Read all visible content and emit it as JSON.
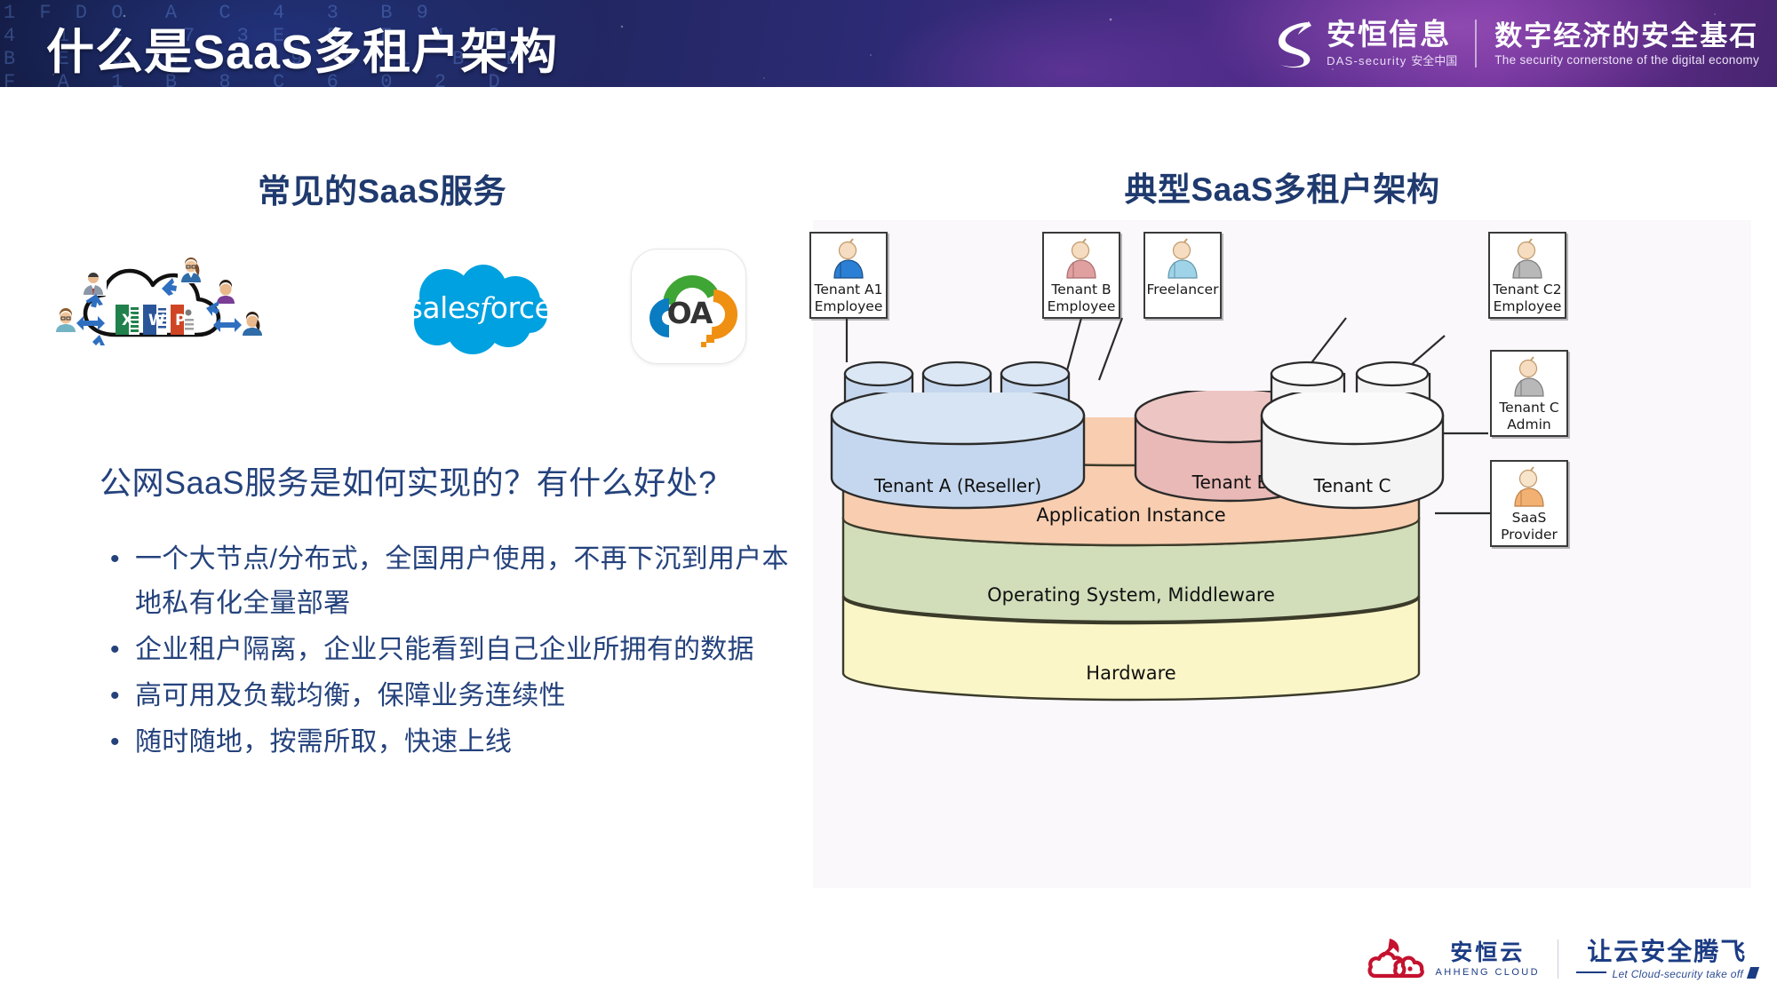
{
  "header": {
    "title": "什么是SaaS多租户架构",
    "code_texts": "1 F D O  A  C  4  3  B 9\n4  1  F   7  3 E  5  F  1  0\nB  E  C  A   2  9  D  1  B  E\nF  A  1  B  8  C  6  0  2  D\nF  O  BE2  F D04  2    1 F D  3  8\n4  7  5926 4   S8   3  C7   2  B",
    "brand": {
      "logo_icon": "das-security-swoosh-logo",
      "name_cn": "安恒信息",
      "name_en": "DAS-security",
      "name_en_suffix": "安全中国",
      "tagline_cn": "数字经济的安全基石",
      "tagline_en": "The security cornerstone of the digital economy"
    },
    "accent_dark": "#121a3e",
    "accent_purple": "#6b2f97"
  },
  "left": {
    "heading": "常见的SaaS服务",
    "logos": [
      {
        "name": "cloud-users-office-illustration",
        "label": ""
      },
      {
        "name": "salesforce-logo",
        "label": "salesforce",
        "label_pre": "sale",
        "label_italic": "sf",
        "label_post": "orce",
        "color": "#00a1e0"
      },
      {
        "name": "oa-cloud-logo",
        "label": "OA",
        "colors": [
          "#0a7cc1",
          "#3fa535",
          "#ef9012"
        ]
      }
    ],
    "subtitle": "公网SaaS服务是如何实现的？有什么好处?",
    "bullet_marker": "•",
    "bullets": [
      "一个大节点/分布式，全国用户使用，不再下沉到用户本地私有化全量部署",
      "企业租户隔离，企业只能看到自己企业所拥有的数据",
      "高可用及负载均衡，保障业务连续性",
      "随时随地，按需所取，快速上线"
    ],
    "text_color": "#24427c",
    "heading_color": "#1f3a6e"
  },
  "right": {
    "heading": "典型SaaS多租户架构",
    "panel_bg": "#fbf8fc",
    "diagram": {
      "actors": [
        {
          "name": "tenant-a1-employee",
          "label": "Tenant A1\nEmployee",
          "figure_color": "#2b7fd4"
        },
        {
          "name": "tenant-b-employee",
          "label": "Tenant B\nEmployee",
          "figure_color": "#e0a0a0"
        },
        {
          "name": "freelancer",
          "label": "Freelancer",
          "figure_color": "#9fd4e8"
        },
        {
          "name": "tenant-c2-employee",
          "label": "Tenant C2\nEmployee",
          "figure_color": "#b8b8b8"
        },
        {
          "name": "tenant-c-admin",
          "label": "Tenant C\nAdmin",
          "figure_color": "#b8b8b8"
        },
        {
          "name": "saas-provider",
          "label": "SaaS\nProvider",
          "figure_color": "#f2b173"
        }
      ],
      "tenants": [
        {
          "name": "tenant-a",
          "label": "Tenant A (Reseller)",
          "color": "#c5d7ee",
          "databases": [
            "A1",
            "A2",
            "A3"
          ]
        },
        {
          "name": "tenant-b",
          "label": "Tenant B",
          "color": "#e8b9b6",
          "databases": []
        },
        {
          "name": "tenant-c",
          "label": "Tenant C",
          "color": "#f2f2f2",
          "databases": [
            "C1",
            "C2"
          ]
        }
      ],
      "layers": [
        {
          "name": "application-instance-layer",
          "label": "Application Instance",
          "color": "#f8cdb0"
        },
        {
          "name": "os-middleware-layer",
          "label": "Operating System, Middleware",
          "color": "#d2ddba"
        },
        {
          "name": "hardware-layer",
          "label": "Hardware",
          "color": "#fbf6c8"
        }
      ]
    }
  },
  "footer": {
    "logo_icon": "ahheng-cloud-rocket-logo",
    "name_cn": "安恒云",
    "name_en": "AHHENG CLOUD",
    "tagline_cn": "让云安全腾飞",
    "tagline_en": "Let Cloud-security take off",
    "color": "#1b3c84",
    "logo_color": "#c4122f"
  }
}
